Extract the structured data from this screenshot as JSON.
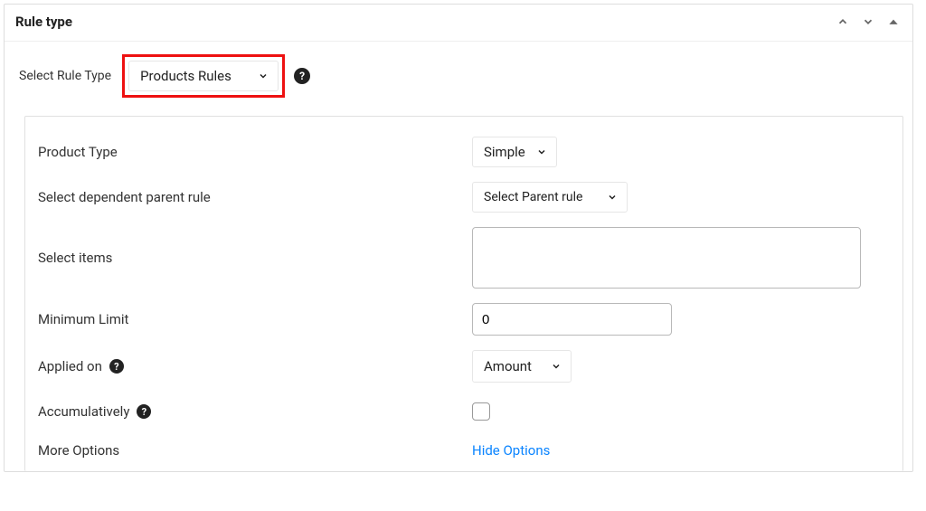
{
  "panel": {
    "title": "Rule type"
  },
  "top_row": {
    "label": "Select Rule Type",
    "value": "Products Rules"
  },
  "form": {
    "product_type": {
      "label": "Product Type",
      "value": "Simple"
    },
    "parent_rule": {
      "label": "Select dependent parent rule",
      "value": "Select Parent rule"
    },
    "select_items": {
      "label": "Select items"
    },
    "min_limit": {
      "label": "Minimum Limit",
      "value": "0"
    },
    "applied_on": {
      "label": "Applied on",
      "value": "Amount"
    },
    "accumulatively": {
      "label": "Accumulatively"
    },
    "more_options": {
      "label": "More Options",
      "toggle_text": "Hide Options"
    }
  }
}
